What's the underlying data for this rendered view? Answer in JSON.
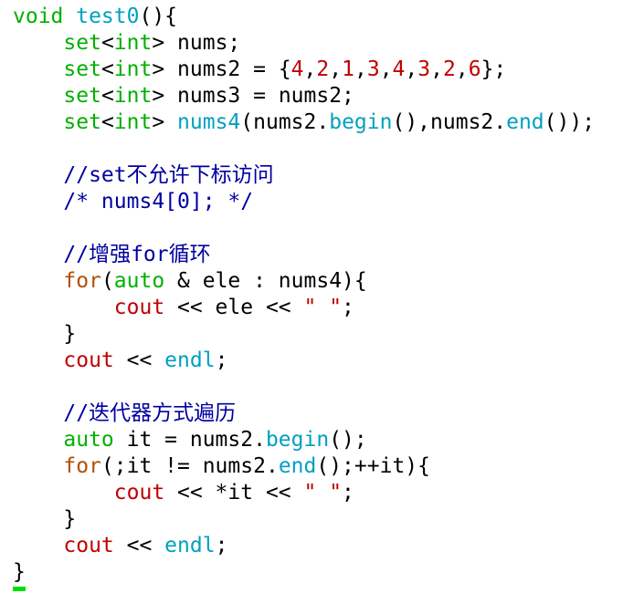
{
  "editor": {
    "colors": {
      "plain": "#000000",
      "keyword": "#00b000",
      "type": "#00b000",
      "number": "#c00000",
      "string": "#c00000",
      "identifier": "#00a0c0",
      "control": "#b05000",
      "comment": "#0000a0",
      "stream": "#c00000",
      "cursor": "#00e000"
    },
    "lines": [
      [
        {
          "t": "void",
          "c": "keyword"
        },
        {
          "t": " test0",
          "c": "identifier"
        },
        {
          "t": "(){",
          "c": "plain"
        }
      ],
      [
        {
          "t": "    set",
          "c": "keyword"
        },
        {
          "t": "<",
          "c": "plain"
        },
        {
          "t": "int",
          "c": "keyword"
        },
        {
          "t": "> nums;",
          "c": "plain"
        }
      ],
      [
        {
          "t": "    set",
          "c": "keyword"
        },
        {
          "t": "<",
          "c": "plain"
        },
        {
          "t": "int",
          "c": "keyword"
        },
        {
          "t": "> nums2 = {",
          "c": "plain"
        },
        {
          "t": "4",
          "c": "number"
        },
        {
          "t": ",",
          "c": "plain"
        },
        {
          "t": "2",
          "c": "number"
        },
        {
          "t": ",",
          "c": "plain"
        },
        {
          "t": "1",
          "c": "number"
        },
        {
          "t": ",",
          "c": "plain"
        },
        {
          "t": "3",
          "c": "number"
        },
        {
          "t": ",",
          "c": "plain"
        },
        {
          "t": "4",
          "c": "number"
        },
        {
          "t": ",",
          "c": "plain"
        },
        {
          "t": "3",
          "c": "number"
        },
        {
          "t": ",",
          "c": "plain"
        },
        {
          "t": "2",
          "c": "number"
        },
        {
          "t": ",",
          "c": "plain"
        },
        {
          "t": "6",
          "c": "number"
        },
        {
          "t": "};",
          "c": "plain"
        }
      ],
      [
        {
          "t": "    set",
          "c": "keyword"
        },
        {
          "t": "<",
          "c": "plain"
        },
        {
          "t": "int",
          "c": "keyword"
        },
        {
          "t": "> nums3 = nums2;",
          "c": "plain"
        }
      ],
      [
        {
          "t": "    set",
          "c": "keyword"
        },
        {
          "t": "<",
          "c": "plain"
        },
        {
          "t": "int",
          "c": "keyword"
        },
        {
          "t": "> ",
          "c": "plain"
        },
        {
          "t": "nums4",
          "c": "identifier"
        },
        {
          "t": "(nums2.",
          "c": "plain"
        },
        {
          "t": "begin",
          "c": "identifier"
        },
        {
          "t": "(),nums2.",
          "c": "plain"
        },
        {
          "t": "end",
          "c": "identifier"
        },
        {
          "t": "());",
          "c": "plain"
        }
      ],
      [
        {
          "t": "",
          "c": "plain"
        }
      ],
      [
        {
          "t": "    //set不允许下标访问",
          "c": "comment"
        }
      ],
      [
        {
          "t": "    /* nums4[0]; */",
          "c": "comment"
        }
      ],
      [
        {
          "t": "",
          "c": "plain"
        }
      ],
      [
        {
          "t": "    //增强for循环",
          "c": "comment"
        }
      ],
      [
        {
          "t": "    for",
          "c": "control"
        },
        {
          "t": "(",
          "c": "plain"
        },
        {
          "t": "auto",
          "c": "keyword"
        },
        {
          "t": " & ele : nums4){",
          "c": "plain"
        }
      ],
      [
        {
          "t": "        cout",
          "c": "stream"
        },
        {
          "t": " << ele << ",
          "c": "plain"
        },
        {
          "t": "\" \"",
          "c": "string"
        },
        {
          "t": ";",
          "c": "plain"
        }
      ],
      [
        {
          "t": "    }",
          "c": "plain"
        }
      ],
      [
        {
          "t": "    cout",
          "c": "stream"
        },
        {
          "t": " << ",
          "c": "plain"
        },
        {
          "t": "endl",
          "c": "identifier"
        },
        {
          "t": ";",
          "c": "plain"
        }
      ],
      [
        {
          "t": "",
          "c": "plain"
        }
      ],
      [
        {
          "t": "    //迭代器方式遍历",
          "c": "comment"
        }
      ],
      [
        {
          "t": "    auto",
          "c": "keyword"
        },
        {
          "t": " it = nums2.",
          "c": "plain"
        },
        {
          "t": "begin",
          "c": "identifier"
        },
        {
          "t": "();",
          "c": "plain"
        }
      ],
      [
        {
          "t": "    for",
          "c": "control"
        },
        {
          "t": "(;it != nums2.",
          "c": "plain"
        },
        {
          "t": "end",
          "c": "identifier"
        },
        {
          "t": "();++it){",
          "c": "plain"
        }
      ],
      [
        {
          "t": "        cout",
          "c": "stream"
        },
        {
          "t": " << *it << ",
          "c": "plain"
        },
        {
          "t": "\" \"",
          "c": "string"
        },
        {
          "t": ";",
          "c": "plain"
        }
      ],
      [
        {
          "t": "    }",
          "c": "plain"
        }
      ],
      [
        {
          "t": "    cout",
          "c": "stream"
        },
        {
          "t": " << ",
          "c": "plain"
        },
        {
          "t": "endl",
          "c": "identifier"
        },
        {
          "t": ";",
          "c": "plain"
        }
      ],
      [
        {
          "t": "}",
          "c": "plain"
        }
      ]
    ]
  }
}
